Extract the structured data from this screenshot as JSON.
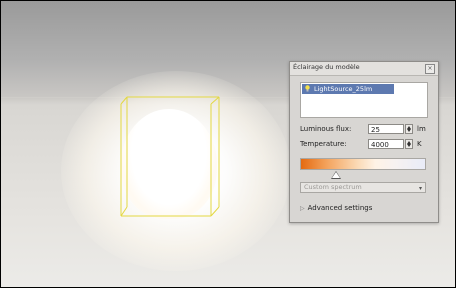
{
  "panel": {
    "title": "Éclairage du modèle",
    "close_icon": "×",
    "light_list": [
      "LightSource_25lm"
    ],
    "luminous_flux_label": "Luminous flux:",
    "luminous_flux_value": "25",
    "luminous_flux_unit": "lm",
    "temperature_label": "Temperature:",
    "temperature_value": "4000",
    "temperature_unit": "K",
    "spectrum_selected": "Custom spectrum",
    "advanced_label": "Advanced settings",
    "icons": [
      "lightbulb-icon",
      "close-icon",
      "spin-up-icon",
      "spin-down-icon",
      "dropdown-arrow-icon",
      "expand-icon"
    ],
    "colors": {
      "selection": "#5d79b0",
      "gradient_warm": "#e46a12",
      "gradient_cool": "#e9ecf8",
      "bbox_lines": "#e3d842"
    }
  }
}
